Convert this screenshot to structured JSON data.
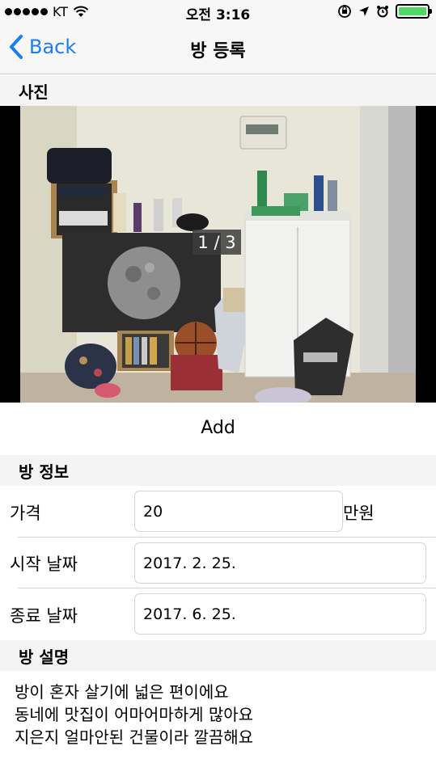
{
  "status_bar": {
    "carrier": "KT",
    "time": "오전 3:16",
    "battery_color": "#4cd964"
  },
  "nav": {
    "back_label": "Back",
    "title": "방 등록",
    "accent": "#1a7ef3"
  },
  "photos": {
    "section_title": "사진",
    "counter": "1 / 3",
    "add_label": "Add"
  },
  "info": {
    "section_title": "방 정보",
    "price_label": "가격",
    "price_value": "20",
    "price_unit": "만원",
    "start_label": "시작 날짜",
    "start_value": "2017. 2. 25.",
    "end_label": "종료 날짜",
    "end_value": "2017. 6. 25."
  },
  "description": {
    "section_title": "방 설명",
    "lines": [
      "방이 혼자 살기에 넓은 편이에요",
      "동네에 맛집이 어마어마하게 많아요",
      "지은지 얼마안된 건물이라 깔끔해요"
    ]
  }
}
